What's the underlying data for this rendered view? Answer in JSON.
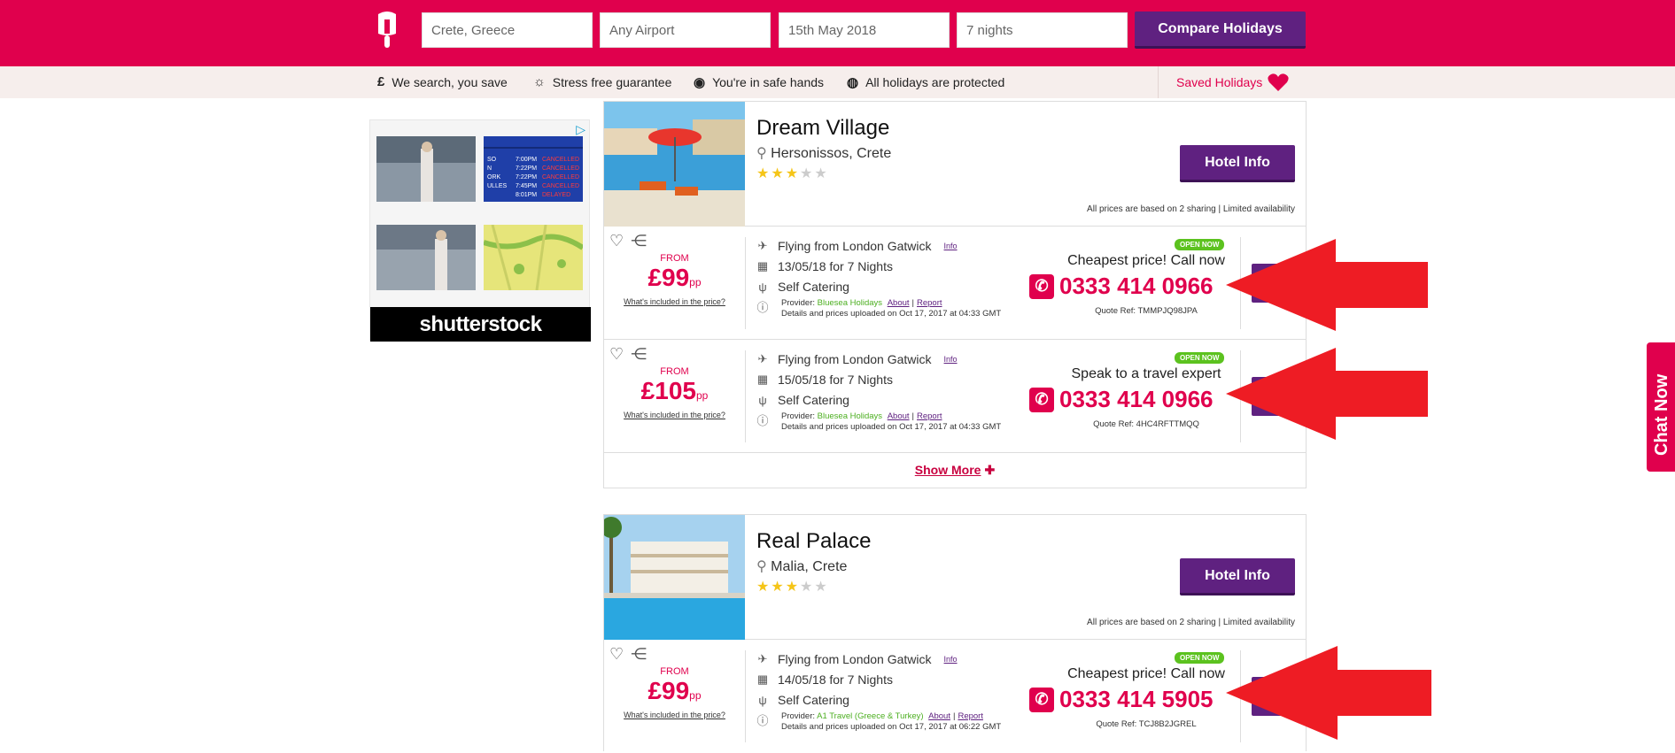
{
  "search": {
    "destination": "Crete, Greece",
    "airport": "Any Airport",
    "date": "15th May 2018",
    "nights": "7 nights",
    "compare_label": "Compare Holidays"
  },
  "subbar": {
    "items": [
      {
        "icon": "pound-icon",
        "glyph": "£",
        "label": "We search, you save"
      },
      {
        "icon": "sun-icon",
        "glyph": "☼",
        "label": "Stress free guarantee"
      },
      {
        "icon": "eye-icon",
        "glyph": "◉",
        "label": "You're in safe hands"
      },
      {
        "icon": "shield-pound-icon",
        "glyph": "◍",
        "label": "All holidays are protected"
      }
    ],
    "saved_label": "Saved Holidays"
  },
  "ad": {
    "brand": "shutterstock",
    "board_rows": [
      "7:00PM CANCELLED",
      "7:22PM CANCELLED",
      "7:22PM CANCELLED",
      "7:45PM CANCELLED",
      "8:01PM DELAYED"
    ]
  },
  "hotels": [
    {
      "name": "Dream Village",
      "location": "Hersonissos, Crete",
      "stars": 3,
      "hotel_info_label": "Hotel Info",
      "sharing_note": "All prices are based on 2 sharing  |  Limited availability",
      "offers": [
        {
          "from": "FROM",
          "price": "£99",
          "pp": "pp",
          "included": "What's included in the price?",
          "flight": "Flying from London Gatwick",
          "info": "Info",
          "dates": "13/05/18 for 7 Nights",
          "board": "Self Catering",
          "provider_prefix": "Provider:",
          "provider": "Bluesea Holidays",
          "about": "About",
          "report": "Report",
          "uploaded": "Details and prices uploaded on Oct 17, 2017 at 04:33 GMT",
          "badge": "OPEN NOW",
          "call_text": "Cheapest price! Call now",
          "phone": "0333 414 0966",
          "quote": "Quote Ref: TMMPJQ98JPA"
        },
        {
          "from": "FROM",
          "price": "£105",
          "pp": "pp",
          "included": "What's included in the price?",
          "flight": "Flying from London Gatwick",
          "info": "Info",
          "dates": "15/05/18 for 7 Nights",
          "board": "Self Catering",
          "provider_prefix": "Provider:",
          "provider": "Bluesea Holidays",
          "about": "About",
          "report": "Report",
          "uploaded": "Details and prices uploaded on Oct 17, 2017 at 04:33 GMT",
          "badge": "OPEN NOW",
          "call_text": "Speak to a travel expert",
          "phone": "0333 414 0966",
          "quote": "Quote Ref: 4HC4RFTTMQQ"
        }
      ],
      "show_more": "Show More"
    },
    {
      "name": "Real Palace",
      "location": "Malia, Crete",
      "stars": 3,
      "hotel_info_label": "Hotel Info",
      "sharing_note": "All prices are based on 2 sharing  |  Limited availability",
      "offers": [
        {
          "from": "FROM",
          "price": "£99",
          "pp": "pp",
          "included": "What's included in the price?",
          "flight": "Flying from London Gatwick",
          "info": "Info",
          "dates": "14/05/18 for 7 Nights",
          "board": "Self Catering",
          "provider_prefix": "Provider:",
          "provider": "A1 Travel (Greece & Turkey)",
          "about": "About",
          "report": "Report",
          "uploaded": "Details and prices uploaded on Oct 17, 2017 at 06:22 GMT",
          "badge": "OPEN NOW",
          "call_text": "Cheapest price! Call now",
          "phone": "0333 414 5905",
          "quote": "Quote Ref: TCJ8B2JGREL"
        }
      ]
    }
  ],
  "chat_label": "Chat Now",
  "colors": {
    "brand": "#e0004d",
    "purple": "#5f2180",
    "open_green": "#5cc21f",
    "arrow_red": "#ee1c24"
  }
}
